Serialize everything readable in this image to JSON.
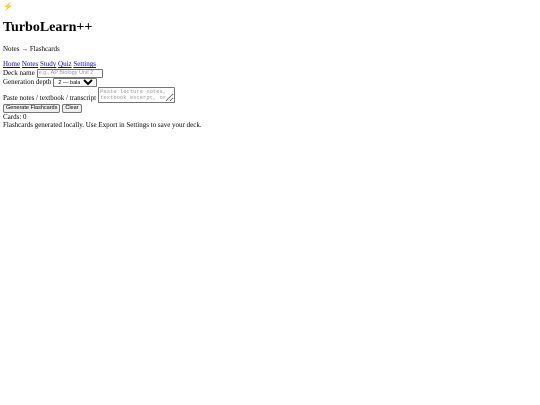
{
  "app": {
    "logo_icon": "⚡",
    "title": "TurboLearn++",
    "subtitle": "Notes → Flashcards"
  },
  "nav": {
    "links": [
      "Home",
      "Notes",
      "Study",
      "Quiz",
      "Settings"
    ]
  },
  "form": {
    "deck_name_label": "Deck name",
    "deck_name_placeholder": "e.g., AP Biology Unit 2",
    "depth_label": "Generation depth",
    "depth_selected": "2 — balanced",
    "notes_label": "Paste notes / textbook / transcript",
    "notes_placeholder": "Paste lecture notes, textbook excerpt, or transcript...",
    "generate_label": "Generate Flashcards",
    "clear_label": "Clear"
  },
  "status": {
    "cards_label": "Cards: 0",
    "message": "Flashcards generated locally. Use Export in Settings to save your deck."
  }
}
